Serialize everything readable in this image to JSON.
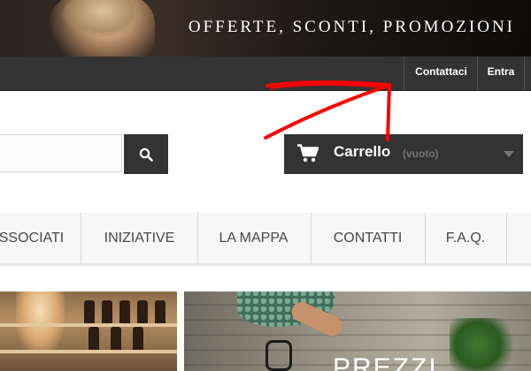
{
  "banner": {
    "title": "OFFERTE, SCONTI, PROMOZIONI"
  },
  "topnav": {
    "contact": "Contattaci",
    "login": "Entra"
  },
  "search": {
    "placeholder": "",
    "button_icon": "search-icon"
  },
  "cart": {
    "label": "Carrello",
    "status": "(vuoto)",
    "icon": "cart-icon",
    "arrow_icon": "chevron-down-icon"
  },
  "menu": {
    "items": [
      {
        "label": "SSOCIATI"
      },
      {
        "label": "INIZIATIVE"
      },
      {
        "label": "LA MAPPA"
      },
      {
        "label": "CONTATTI"
      },
      {
        "label": "F.A.Q."
      }
    ]
  },
  "promo": {
    "text": "PREZZI"
  },
  "colors": {
    "dark_bar": "#333333",
    "annotation": "#ff0000",
    "menu_bg": "#f6f6f6"
  }
}
